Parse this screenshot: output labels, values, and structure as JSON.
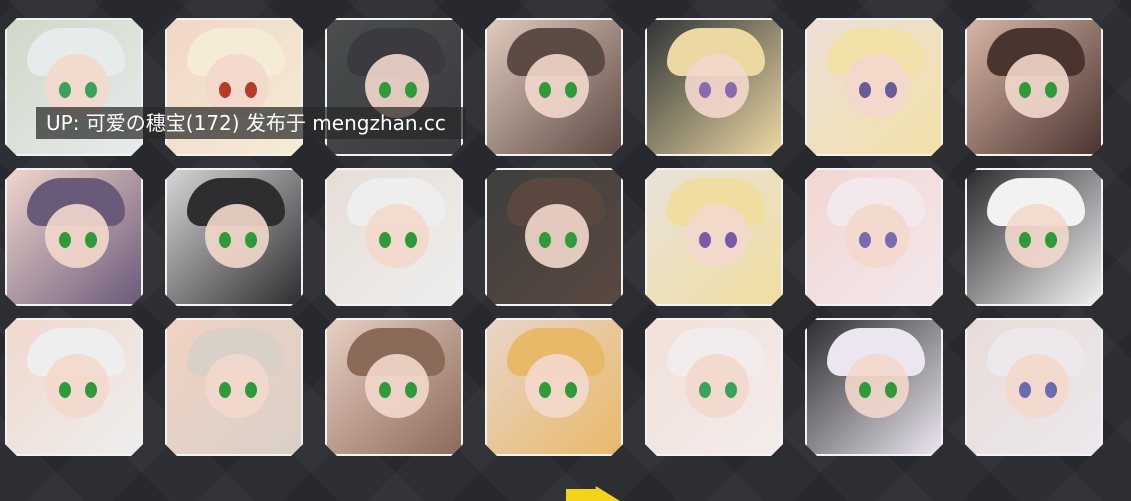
{
  "uploader_label": "UP: 可爱の穗宝(172) 发布于 mengzhan.cc",
  "thumbnails": [
    {
      "name": "thumb-1",
      "hair": "#e6ecec",
      "bg": "#cfd8c8",
      "eye": "#3aa35a"
    },
    {
      "name": "thumb-2",
      "hair": "#f4ecd6",
      "bg": "#f1d6c7",
      "eye": "#b63a2a"
    },
    {
      "name": "thumb-3",
      "hair": "#3a3a40",
      "bg": "#4a4e4c",
      "eye": "#2f9a3a"
    },
    {
      "name": "thumb-4",
      "hair": "#5c4a44",
      "bg": "#e2cbbd",
      "eye": "#2f9a3a"
    },
    {
      "name": "thumb-5",
      "hair": "#ecd8a3",
      "bg": "#2f3436",
      "eye": "#8a6ab0"
    },
    {
      "name": "thumb-6",
      "hair": "#f2e1a8",
      "bg": "#ece0d8",
      "eye": "#6a5a9a"
    },
    {
      "name": "thumb-7",
      "hair": "#4a3430",
      "bg": "#d9b6a6",
      "eye": "#2f9a3a"
    },
    {
      "name": "thumb-8",
      "hair": "#6a5a7a",
      "bg": "#f0d6cc",
      "eye": "#2f9a3a"
    },
    {
      "name": "thumb-9",
      "hair": "#2e2e30",
      "bg": "#d6d6d6",
      "eye": "#2f9a3a"
    },
    {
      "name": "thumb-10",
      "hair": "#eeeeee",
      "bg": "#e6ddd6",
      "eye": "#2f9a3a"
    },
    {
      "name": "thumb-11",
      "hair": "#5a4840",
      "bg": "#3e3f3e",
      "eye": "#2f9a3a"
    },
    {
      "name": "thumb-12",
      "hair": "#f0dea0",
      "bg": "#e8e2da",
      "eye": "#7a5aa6"
    },
    {
      "name": "thumb-13",
      "hair": "#f3e8ec",
      "bg": "#f1d6d2",
      "eye": "#7a6ab0"
    },
    {
      "name": "thumb-14",
      "hair": "#f2f2f2",
      "bg": "#2c2c30",
      "eye": "#2f9a3a"
    },
    {
      "name": "thumb-15",
      "hair": "#eeeeee",
      "bg": "#f0d8cc",
      "eye": "#2f9a3a"
    },
    {
      "name": "thumb-16",
      "hair": "#d9d0c8",
      "bg": "#f0d2c2",
      "eye": "#2f9a3a"
    },
    {
      "name": "thumb-17",
      "hair": "#8b6a5a",
      "bg": "#e9cfc4",
      "eye": "#2f9a3a"
    },
    {
      "name": "thumb-18",
      "hair": "#e9b96a",
      "bg": "#e8d4c8",
      "eye": "#2f9a3a"
    },
    {
      "name": "thumb-19",
      "hair": "#f3ecec",
      "bg": "#f2e0d8",
      "eye": "#3aa35a"
    },
    {
      "name": "thumb-20",
      "hair": "#ece6f0",
      "bg": "#2c2e30",
      "eye": "#2f9a3a"
    },
    {
      "name": "thumb-21",
      "hair": "#ece8ec",
      "bg": "#e8dcd8",
      "eye": "#6a6ab0"
    }
  ],
  "colors": {
    "background": "#2a2b30",
    "thumb_border": "#f2f2f2",
    "arrow": "#f5d31a"
  },
  "icons": {
    "next": "arrow-icon"
  }
}
